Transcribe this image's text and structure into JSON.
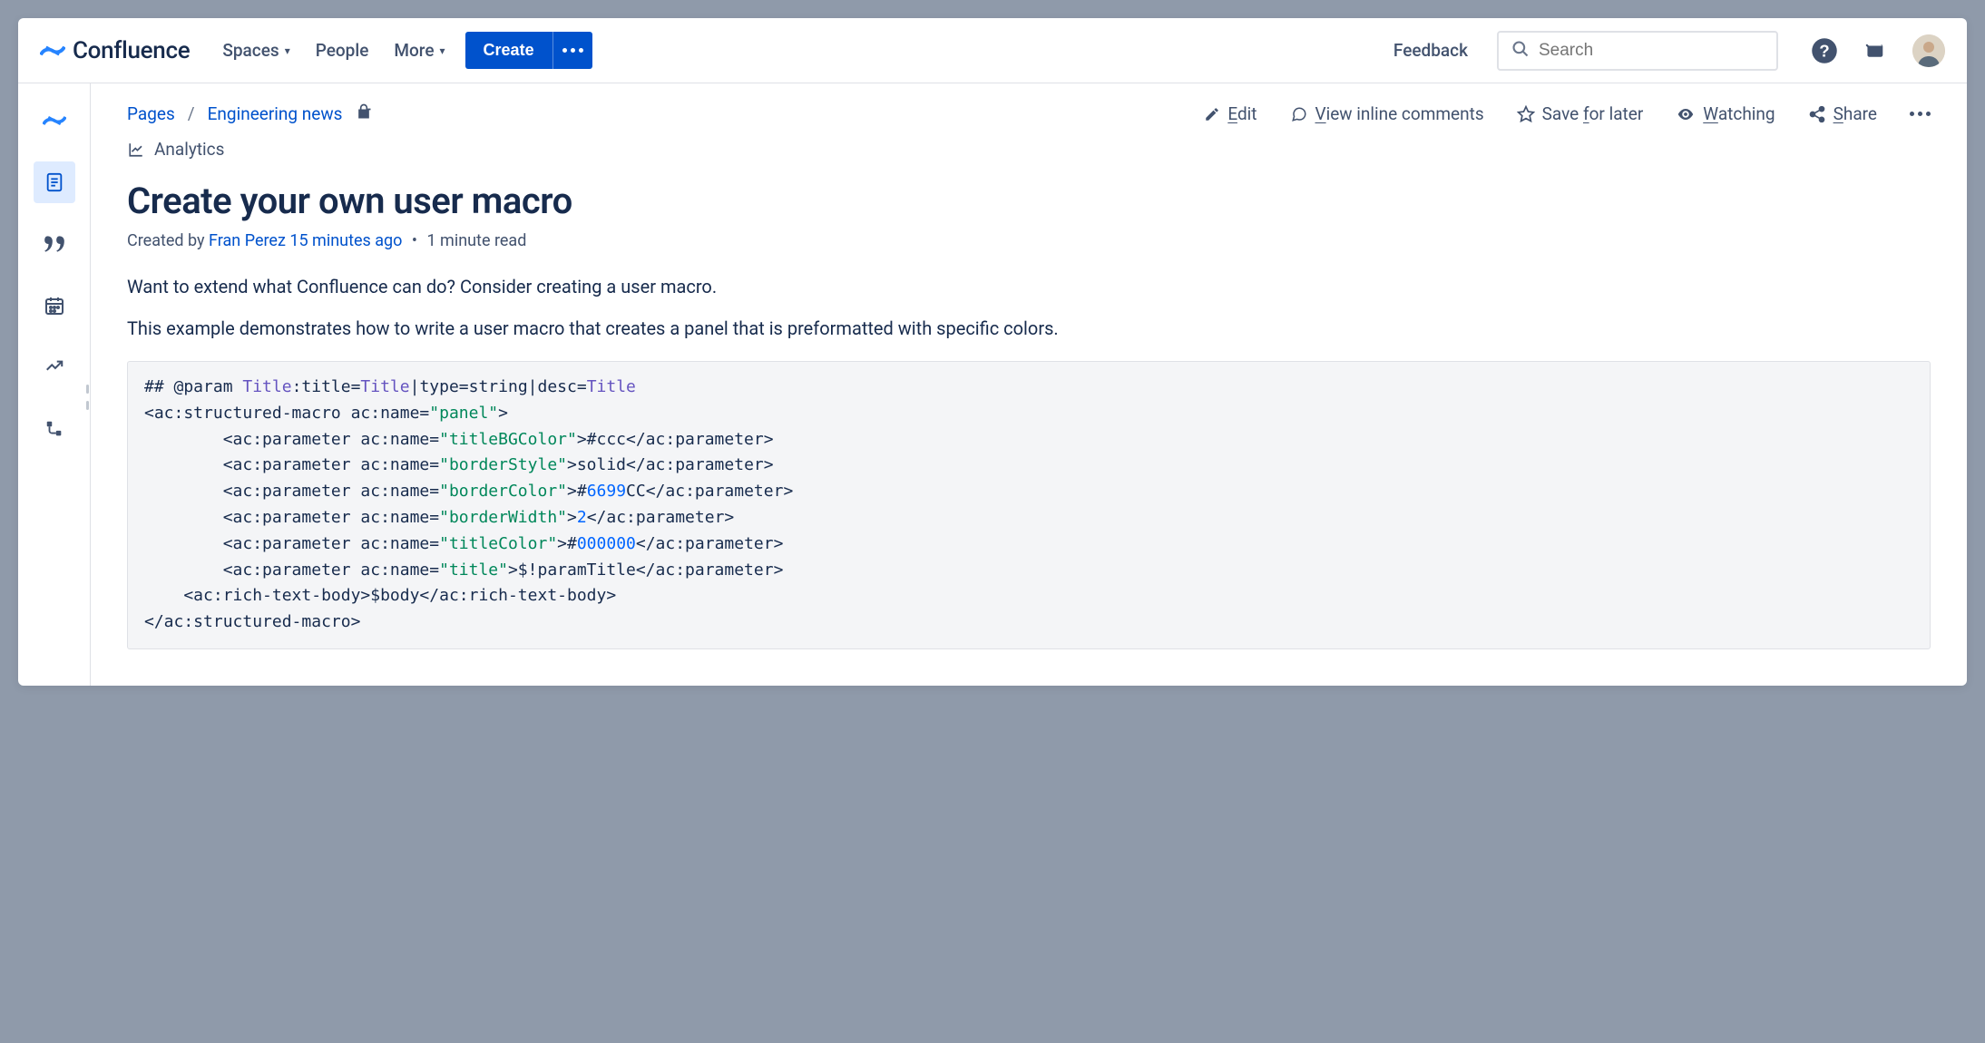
{
  "header": {
    "product": "Confluence",
    "nav": {
      "spaces": "Spaces",
      "people": "People",
      "more": "More"
    },
    "create": "Create",
    "feedback": "Feedback",
    "search_placeholder": "Search"
  },
  "breadcrumb": {
    "pages": "Pages",
    "space": "Engineering news"
  },
  "page_actions": {
    "edit": "Edit",
    "view_inline": "View inline comments",
    "save_for_later": "Save for later",
    "watching": "Watching",
    "share": "Share"
  },
  "analytics": "Analytics",
  "title": "Create your own user macro",
  "byline": {
    "created_by": "Created by ",
    "author": "Fran Perez",
    "when": "15 minutes ago",
    "read": "1 minute read"
  },
  "paragraphs": {
    "p1": "Want to extend what Confluence can do? Consider creating a user macro.",
    "p2": "This example demonstrates how to write a user macro that creates a panel that is preformatted with specific colors."
  },
  "code": {
    "l1a": "## @param ",
    "l1b": "Title",
    "l1c": ":title=",
    "l1d": "Title",
    "l1e": "|type=string|desc=",
    "l1f": "Title",
    "l2a": "<ac:structured-macro ac:name=",
    "l2b": "\"panel\"",
    "l2c": ">",
    "l3a": "        <ac:parameter ac:name=",
    "l3b": "\"titleBGColor\"",
    "l3c": ">#ccc</ac:parameter>",
    "l4b": "\"borderStyle\"",
    "l4c": ">solid</ac:parameter>",
    "l5b": "\"borderColor\"",
    "l5c": ">#",
    "l5d": "6699",
    "l5e": "CC</ac:parameter>",
    "l6b": "\"borderWidth\"",
    "l6c": ">",
    "l6d": "2",
    "l6e": "</ac:parameter>",
    "l7b": "\"titleColor\"",
    "l7c": ">#",
    "l7d": "000000",
    "l7e": "</ac:parameter>",
    "l8b": "\"title\"",
    "l8c": ">$!paramTitle</ac:parameter>",
    "l9": "    <ac:rich-text-body>$body</ac:rich-text-body>",
    "l10": "</ac:structured-macro>"
  }
}
